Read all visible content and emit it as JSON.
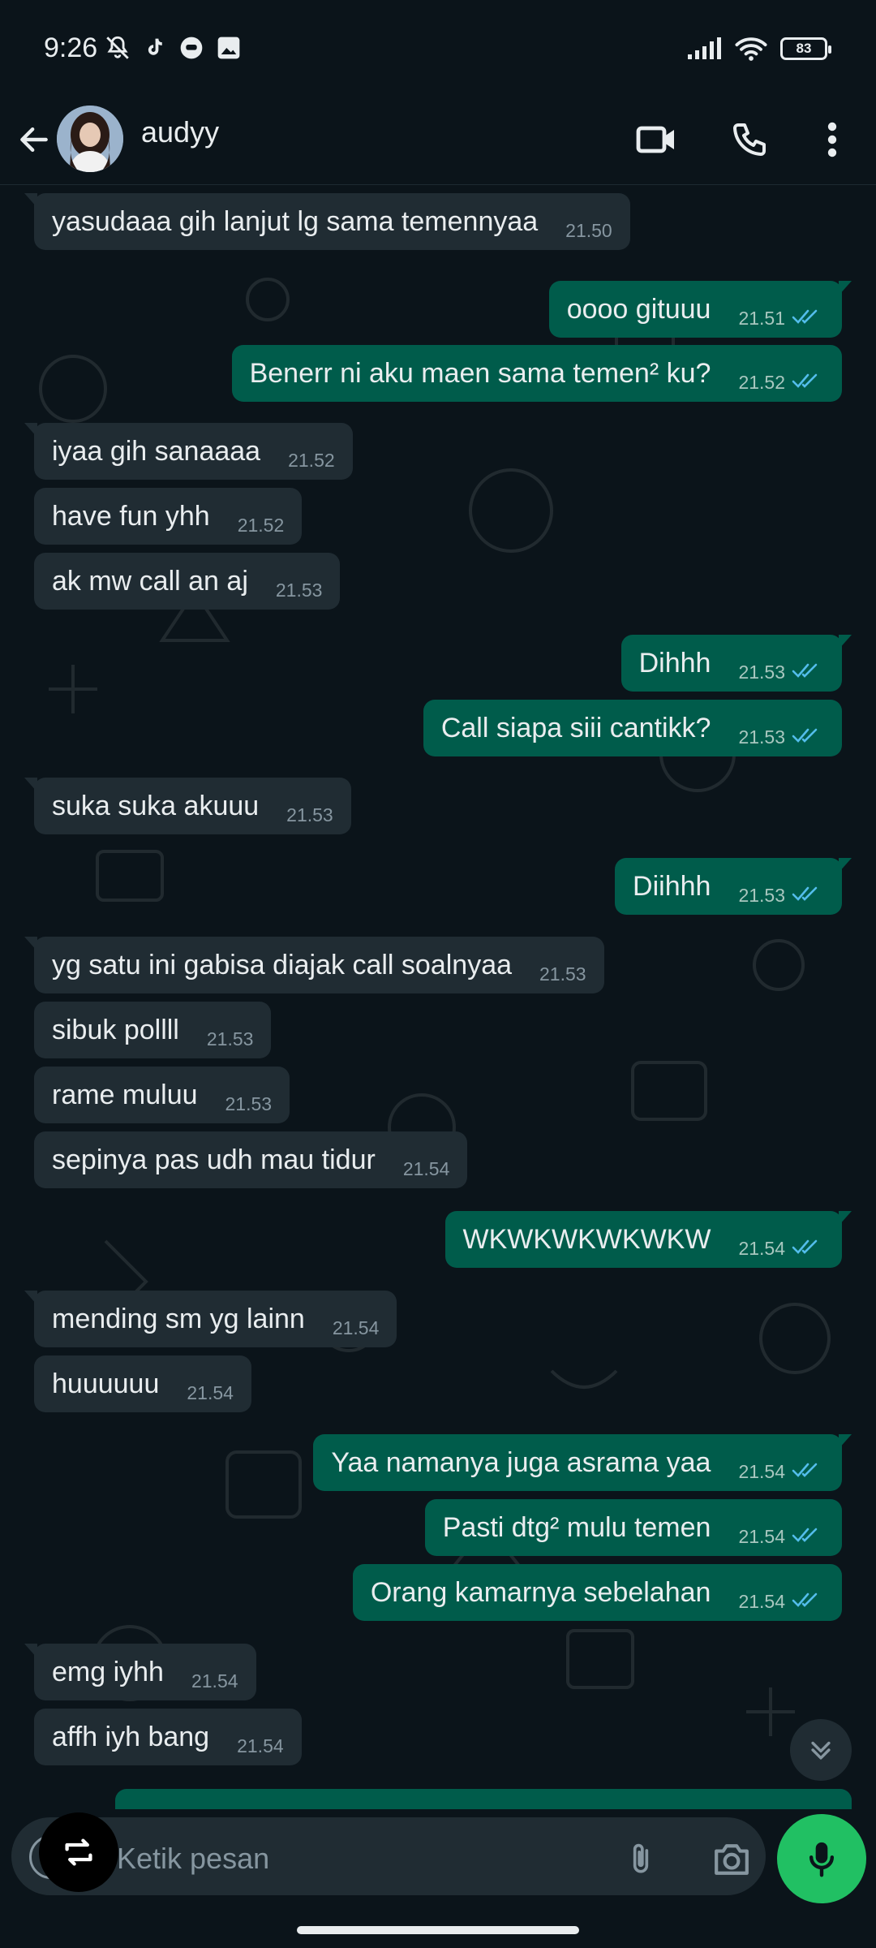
{
  "status_bar": {
    "time": "9:26",
    "battery": "83",
    "left_icons": [
      "mute-icon",
      "tiktok-icon",
      "message-icon",
      "gallery-icon"
    ],
    "right_icons": [
      "signal-icon",
      "wifi-icon",
      "battery-icon"
    ]
  },
  "header": {
    "contact_name": "audyy",
    "icons": [
      "back-arrow-icon",
      "avatar",
      "video-call-icon",
      "voice-call-icon",
      "more-vert-icon"
    ]
  },
  "messages": [
    {
      "dir": "in",
      "text": "yasudaaa gih lanjut lg sama temennyaa",
      "time": "21.50"
    },
    {
      "dir": "out",
      "text": "oooo gituuu",
      "time": "21.51"
    },
    {
      "dir": "out",
      "text": "Benerr ni aku maen sama temen² ku?",
      "time": "21.52"
    },
    {
      "dir": "in",
      "text": "iyaa gih sanaaaa",
      "time": "21.52"
    },
    {
      "dir": "in",
      "text": "have fun yhh",
      "time": "21.52"
    },
    {
      "dir": "in",
      "text": "ak mw call an aj",
      "time": "21.53"
    },
    {
      "dir": "out",
      "text": "Dihhh",
      "time": "21.53"
    },
    {
      "dir": "out",
      "text": "Call siapa siii cantikk?",
      "time": "21.53"
    },
    {
      "dir": "in",
      "text": "suka suka akuuu",
      "time": "21.53"
    },
    {
      "dir": "out",
      "text": "Diihhh",
      "time": "21.53"
    },
    {
      "dir": "in",
      "text": "yg satu ini gabisa diajak call soalnyaa",
      "time": "21.53"
    },
    {
      "dir": "in",
      "text": "sibuk pollll",
      "time": "21.53"
    },
    {
      "dir": "in",
      "text": "rame muluu",
      "time": "21.53"
    },
    {
      "dir": "in",
      "text": "sepinya pas udh mau tidur",
      "time": "21.54"
    },
    {
      "dir": "out",
      "text": "WKWKWKWKWKW",
      "time": "21.54"
    },
    {
      "dir": "in",
      "text": "mending sm yg lainn",
      "time": "21.54"
    },
    {
      "dir": "in",
      "text": "huuuuuu",
      "time": "21.54"
    },
    {
      "dir": "out",
      "text": "Yaa namanya juga asrama yaa",
      "time": "21.54"
    },
    {
      "dir": "out",
      "text": "Pasti dtg² mulu temen",
      "time": "21.54"
    },
    {
      "dir": "out",
      "text": "Orang kamarnya sebelahan",
      "time": "21.54"
    },
    {
      "dir": "in",
      "text": "emg iyhh",
      "time": "21.54"
    },
    {
      "dir": "in",
      "text": "affh iyh bang",
      "time": "21.54"
    }
  ],
  "input": {
    "placeholder": "Ketik pesan",
    "icons": [
      "emoji-icon",
      "attach-icon",
      "camera-icon",
      "mic-icon"
    ]
  },
  "colors": {
    "background": "#0b141a",
    "incoming_bubble": "#202c33",
    "outgoing_bubble": "#005c4b",
    "read_tick": "#53bdeb",
    "mic_button": "#21c063"
  }
}
